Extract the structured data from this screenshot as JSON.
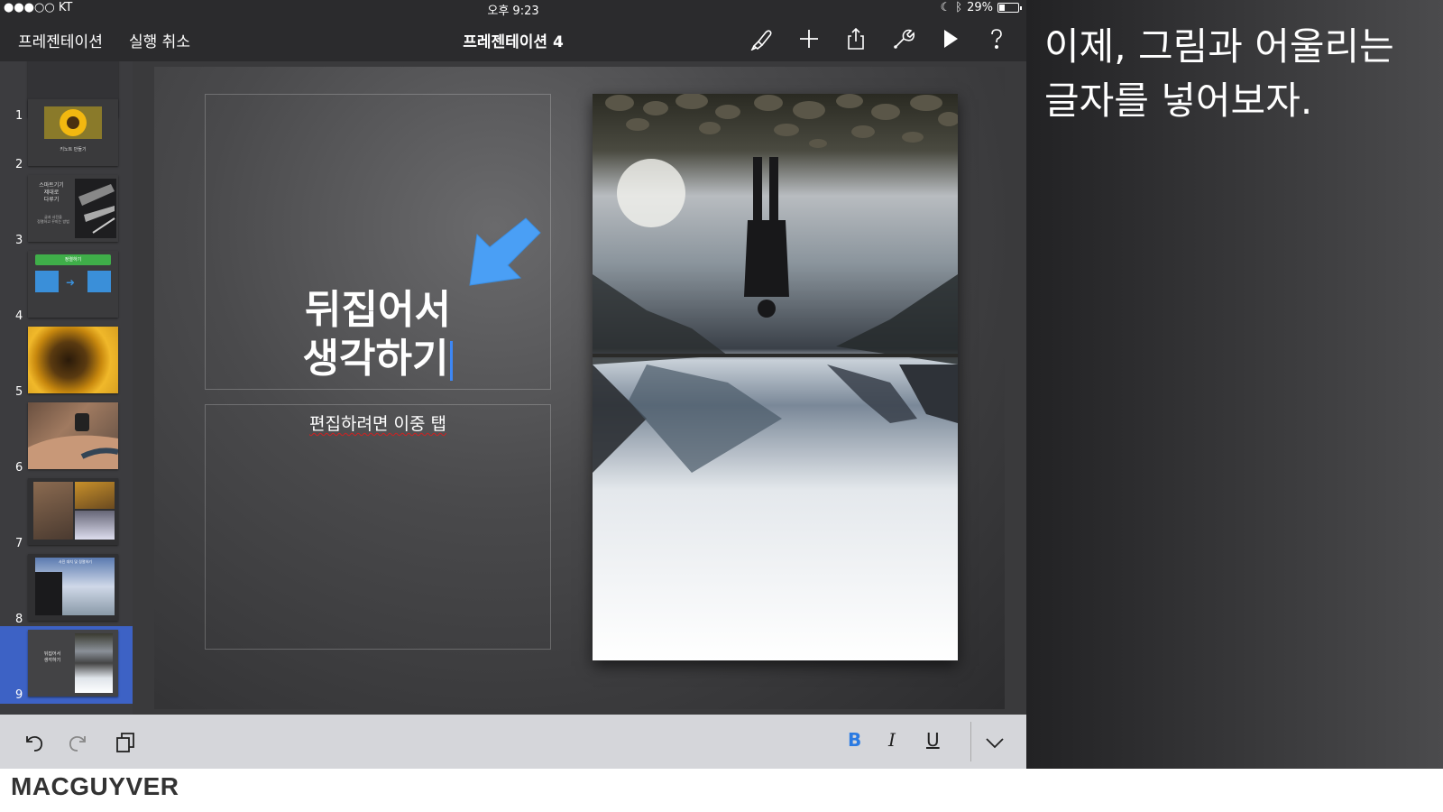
{
  "status_bar": {
    "carrier": "●●●○○ KT",
    "time": "오후 9:23",
    "battery": "29%",
    "battery_level": 0.29
  },
  "toolbar": {
    "presentations_label": "프레젠테이션",
    "undo_label": "실행 취소",
    "document_title": "프레젠테이션 4",
    "icons": [
      "paintbrush-icon",
      "plus-icon",
      "share-icon",
      "wrench-icon",
      "play-icon",
      "help-icon"
    ]
  },
  "sidebar": {
    "slides": [
      {
        "number": "1"
      },
      {
        "number": "2",
        "caption": "키노트 만들기"
      },
      {
        "number": "3",
        "title": "스마트기기\n제대로\n다루기",
        "caption": "글과 사진을\n정렬하고 꾸미는 방법"
      },
      {
        "number": "4",
        "label": "정렬하기"
      },
      {
        "number": "5"
      },
      {
        "number": "6"
      },
      {
        "number": "7"
      },
      {
        "number": "8",
        "caption": "사진 대치 및 정렬하기"
      },
      {
        "number": "9",
        "title": "뒤집어서\n생각하기",
        "selected": true
      }
    ]
  },
  "slide": {
    "title_line1": "뒤집어서",
    "title_line2": "생각하기",
    "body_placeholder": "편집하려면 이중 탭"
  },
  "format_bar": {
    "bold": "B",
    "italic": "I",
    "underline": "U",
    "bold_color": "#2a7ae2"
  },
  "annotation": {
    "text": "이제, 그림과 어울리는 글자를 넣어보자."
  },
  "watermark": "MACGUYVER",
  "colors": {
    "arrow": "#4a9ff5",
    "selected_slide": "#3d62c5"
  }
}
